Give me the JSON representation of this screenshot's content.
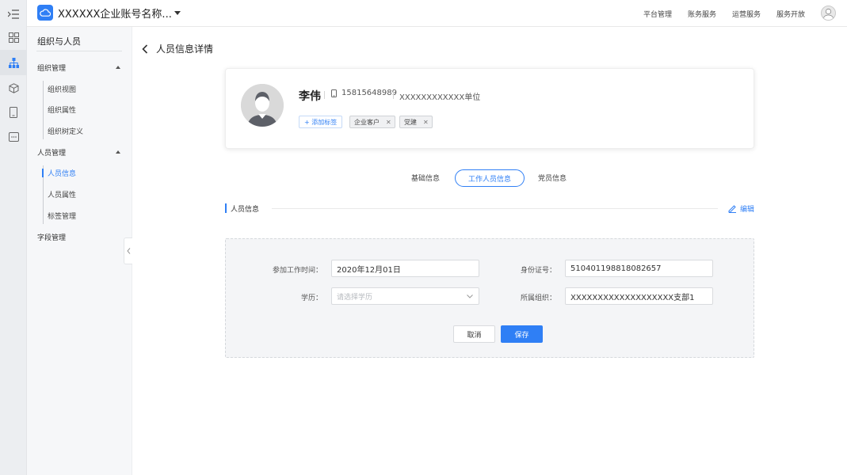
{
  "header": {
    "account_name": "XXXXXX企业账号名称...",
    "nav": [
      "平台管理",
      "账务服务",
      "运营服务",
      "服务开放"
    ]
  },
  "rail": {
    "icons": [
      "menu-toggle-icon",
      "apps-grid-icon",
      "org-tree-icon",
      "cube-icon",
      "device-icon",
      "message-icon"
    ]
  },
  "sidebar": {
    "title": "组织与人员",
    "groups": [
      {
        "label": "组织管理",
        "items": [
          "组织视图",
          "组织属性",
          "组织树定义"
        ]
      },
      {
        "label": "人员管理",
        "items": [
          "人员信息",
          "人员属性",
          "标签管理"
        ]
      },
      {
        "label": "字段管理",
        "items": []
      }
    ],
    "active_item": "人员信息"
  },
  "page": {
    "title": "人员信息详情"
  },
  "profile": {
    "name": "李伟",
    "phone": "15815648989",
    "unit": "XXXXXXXXXXXX单位",
    "add_tag_label": "+ 添加标签",
    "tags": [
      "企业客户",
      "党建"
    ]
  },
  "tabs": {
    "items": [
      "基础信息",
      "工作人员信息",
      "党员信息"
    ],
    "active": "工作人员信息"
  },
  "section": {
    "title": "人员信息",
    "edit_label": "编辑"
  },
  "form": {
    "fields": {
      "work_start": {
        "label": "参加工作时间：",
        "value": "2020年12月01日"
      },
      "id_number": {
        "label": "身份证号：",
        "value": "510401198818082657"
      },
      "education": {
        "label": "学历：",
        "placeholder": "请选择学历"
      },
      "org": {
        "label": "所属组织：",
        "value": "XXXXXXXXXXXXXXXXXXX支部1"
      }
    },
    "cancel_label": "取消",
    "save_label": "保存"
  },
  "colors": {
    "accent": "#2f7ff5"
  }
}
